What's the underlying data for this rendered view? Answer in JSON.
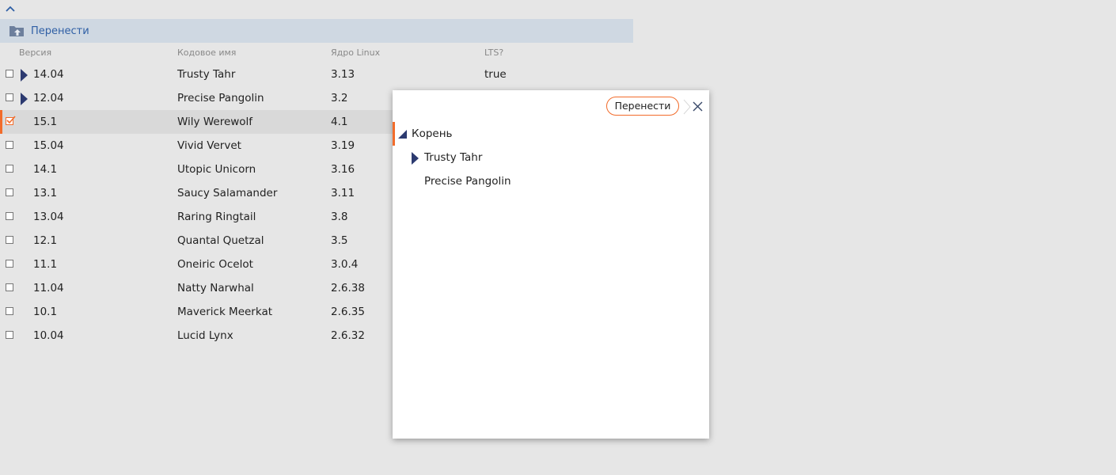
{
  "toolbar": {
    "move_label": "Перенести"
  },
  "table": {
    "columns": [
      "Версия",
      "Кодовое имя",
      "Ядро Linux",
      "LTS?"
    ],
    "rows": [
      {
        "version": "14.04",
        "codename": "Trusty Tahr",
        "kernel": "3.13",
        "lts": "true",
        "expandable": true,
        "checked": false,
        "selected": false
      },
      {
        "version": "12.04",
        "codename": "Precise Pangolin",
        "kernel": "3.2",
        "lts": "",
        "expandable": true,
        "checked": false,
        "selected": false
      },
      {
        "version": "15.1",
        "codename": "Wily Werewolf",
        "kernel": "4.1",
        "lts": "",
        "expandable": false,
        "checked": true,
        "selected": true
      },
      {
        "version": "15.04",
        "codename": "Vivid Vervet",
        "kernel": "3.19",
        "lts": "",
        "expandable": false,
        "checked": false,
        "selected": false
      },
      {
        "version": "14.1",
        "codename": "Utopic Unicorn",
        "kernel": "3.16",
        "lts": "",
        "expandable": false,
        "checked": false,
        "selected": false
      },
      {
        "version": "13.1",
        "codename": "Saucy Salamander",
        "kernel": "3.11",
        "lts": "",
        "expandable": false,
        "checked": false,
        "selected": false
      },
      {
        "version": "13.04",
        "codename": "Raring Ringtail",
        "kernel": "3.8",
        "lts": "",
        "expandable": false,
        "checked": false,
        "selected": false
      },
      {
        "version": "12.1",
        "codename": "Quantal Quetzal",
        "kernel": "3.5",
        "lts": "",
        "expandable": false,
        "checked": false,
        "selected": false
      },
      {
        "version": "11.1",
        "codename": "Oneiric Ocelot",
        "kernel": "3.0.4",
        "lts": "",
        "expandable": false,
        "checked": false,
        "selected": false
      },
      {
        "version": "11.04",
        "codename": "Natty Narwhal",
        "kernel": "2.6.38",
        "lts": "",
        "expandable": false,
        "checked": false,
        "selected": false
      },
      {
        "version": "10.1",
        "codename": "Maverick Meerkat",
        "kernel": "2.6.35",
        "lts": "",
        "expandable": false,
        "checked": false,
        "selected": false
      },
      {
        "version": "10.04",
        "codename": "Lucid Lynx",
        "kernel": "2.6.32",
        "lts": "",
        "expandable": false,
        "checked": false,
        "selected": false
      }
    ]
  },
  "dialog": {
    "move_label": "Перенести",
    "tree": {
      "root_label": "Корень",
      "children": [
        {
          "label": "Trusty Tahr",
          "expandable": true
        },
        {
          "label": "Precise Pangolin",
          "expandable": false
        }
      ]
    }
  },
  "colors": {
    "accent": "#f26c2b",
    "toolbar_bg": "#cfd8e2",
    "link": "#2f5fa5",
    "expander": "#2c3a70"
  },
  "icons": {
    "collapse": "chevron-up-icon",
    "move": "folder-upload-icon",
    "close": "close-icon"
  }
}
